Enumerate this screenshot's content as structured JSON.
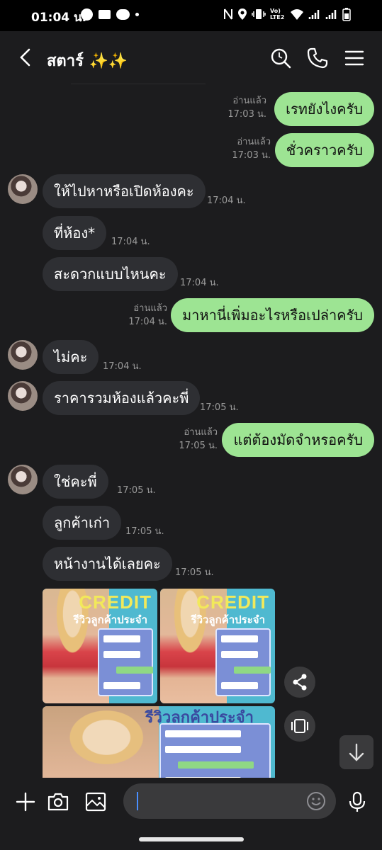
{
  "status_bar": {
    "time": "01:04 น.",
    "network_label": "Vo) LTE2"
  },
  "header": {
    "title": "สตาร์ ✨✨"
  },
  "messages": [
    {
      "side": "out",
      "text": "เรทยังไงครับ",
      "read": "อ่านแล้ว",
      "time": "17:03 น."
    },
    {
      "side": "out",
      "text": "ชั่วคราวครับ",
      "read": "อ่านแล้ว",
      "time": "17:03 น."
    },
    {
      "side": "in",
      "text": "ให้ไปหาหรือเปิดห้องคะ",
      "time": "17:04 น."
    },
    {
      "side": "in",
      "text": "ที่ห้อง*",
      "time": "17:04 น."
    },
    {
      "side": "in",
      "text": "สะดวกแบบไหนคะ",
      "time": "17:04 น."
    },
    {
      "side": "out",
      "text": "มาหานี่เพิ่มอะไรหรือเปล่าครับ",
      "read": "อ่านแล้ว",
      "time": "17:04 น."
    },
    {
      "side": "in",
      "text": "ไม่คะ",
      "time": "17:04 น."
    },
    {
      "side": "in",
      "text": "ราคารวมห้องแล้วคะพี่",
      "time": "17:05 น."
    },
    {
      "side": "out",
      "text": "แต่ต้องมัดจำหรอครับ",
      "read": "อ่านแล้ว",
      "time": "17:05 น."
    },
    {
      "side": "in",
      "text": "ใช่คะพี่",
      "time": "17:05 น."
    },
    {
      "side": "in",
      "text": "ลูกค้าเก่า",
      "time": "17:05 น."
    },
    {
      "side": "in",
      "text": "หน้างานได้เลยคะ",
      "time": "17:05 น."
    }
  ],
  "images": [
    {
      "headline": "CREDIT",
      "subtitle": "รีวิวลูกค้าประจำ"
    },
    {
      "headline": "CREDIT",
      "subtitle": "รีวิวลูกค้าประจำ"
    },
    {
      "headline": "",
      "subtitle": "รีวิวลูกค้าประจำ"
    }
  ],
  "input": {
    "placeholder": ""
  },
  "colors": {
    "outgoing_bubble": "#9de493",
    "incoming_bubble": "#2e2f33",
    "background": "#1c1c1e"
  }
}
